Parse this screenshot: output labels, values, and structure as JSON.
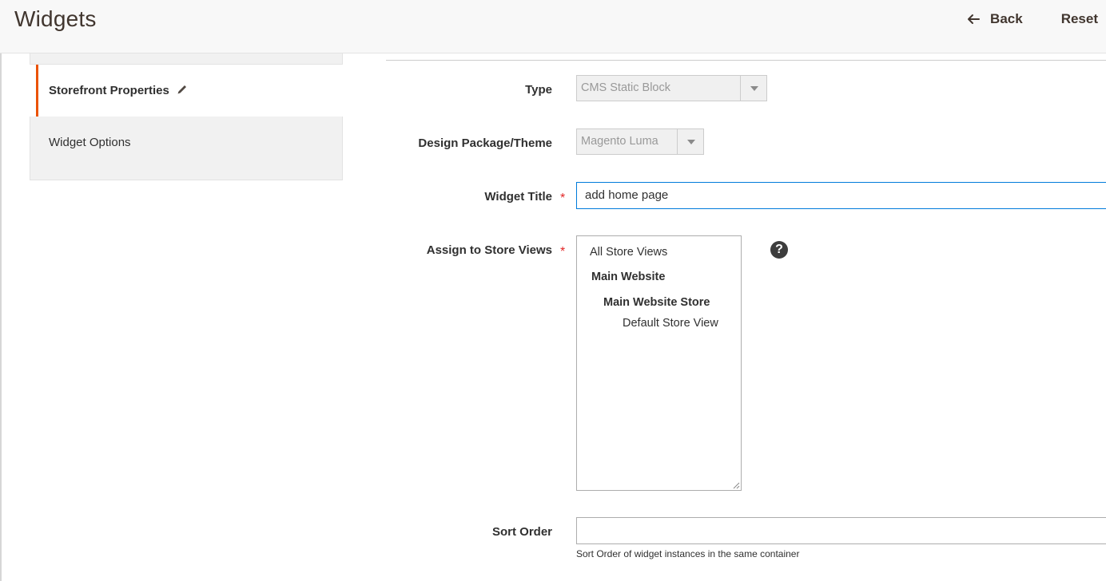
{
  "header": {
    "title": "Widgets",
    "back_label": "Back",
    "reset_label": "Reset"
  },
  "sidebar": {
    "items": [
      {
        "label": "Storefront Properties",
        "active": true
      },
      {
        "label": "Widget Options",
        "active": false
      }
    ]
  },
  "form": {
    "type": {
      "label": "Type",
      "value": "CMS Static Block"
    },
    "theme": {
      "label": "Design Package/Theme",
      "value": "Magento Luma"
    },
    "widget_title": {
      "label": "Widget Title",
      "required": true,
      "value": "add home page"
    },
    "store_views": {
      "label": "Assign to Store Views",
      "required": true,
      "options": [
        {
          "label": "All Store Views",
          "level": 0
        },
        {
          "label": "Main Website",
          "level": 1,
          "group": true
        },
        {
          "label": "Main Website Store",
          "level": 2,
          "group": true
        },
        {
          "label": "Default Store View",
          "level": 3
        }
      ],
      "help": "?"
    },
    "sort_order": {
      "label": "Sort Order",
      "value": "",
      "note": "Sort Order of widget instances in the same container"
    }
  },
  "colors": {
    "accent": "#eb5202",
    "required": "#e22626",
    "focus": "#007bdb"
  }
}
